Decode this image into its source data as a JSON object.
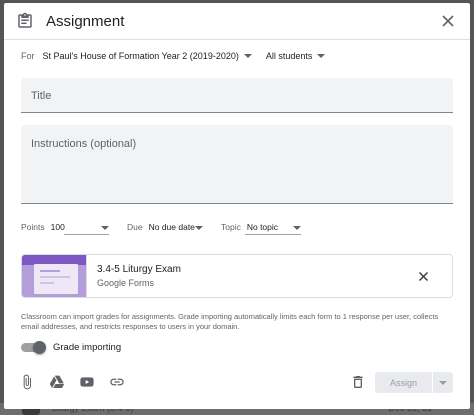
{
  "dialog": {
    "title": "Assignment"
  },
  "for_row": {
    "label": "For",
    "class_value": "St Paul's House of Formation Year 2 (2019-2020)",
    "students_value": "All students"
  },
  "fields": {
    "title_placeholder": "Title",
    "instructions_placeholder": "Instructions (optional)"
  },
  "options": {
    "points_label": "Points",
    "points_value": "100",
    "due_label": "Due",
    "due_value": "No due date",
    "topic_label": "Topic",
    "topic_value": "No topic"
  },
  "attachment": {
    "name": "3.4-5 Liturgy Exam",
    "type": "Google Forms"
  },
  "note": "Classroom can import grades for assignments. Grade importing automatically limits each form to 1 response per user, collects email addresses, and restricts responses to users in your domain.",
  "grade_importing": {
    "label": "Grade importing",
    "enabled": true
  },
  "footer": {
    "assign_label": "Assign"
  },
  "background": {
    "item_text": "Liturgy Exam (3.4-5)",
    "item_date": "Dec 31, 31"
  },
  "colors": {
    "accent": "#7e57c2",
    "thumb": "#b39ddb",
    "disabled_button": "#e8eaed"
  }
}
